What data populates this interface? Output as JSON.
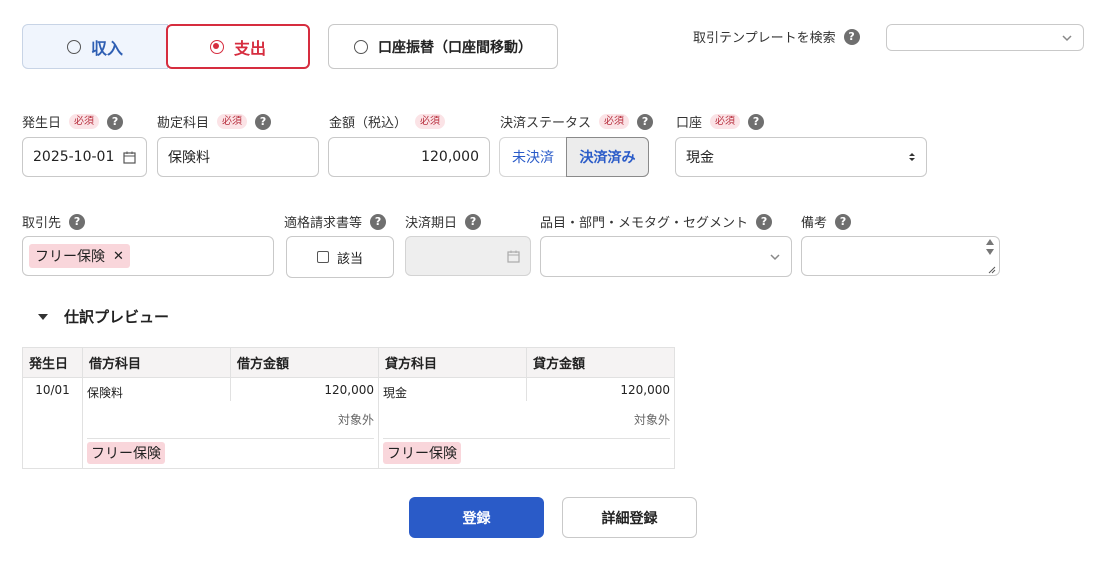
{
  "tabs": {
    "income": "収入",
    "expense": "支出",
    "transfer": "口座振替（口座間移動）"
  },
  "template_search": {
    "label": "取引テンプレートを検索",
    "value": ""
  },
  "required_badge": "必須",
  "help_glyph": "?",
  "fields": {
    "date": {
      "label": "発生日",
      "value": "2025-10-01"
    },
    "account_item": {
      "label": "勘定科目",
      "value": "保険料"
    },
    "amount": {
      "label": "金額（税込）",
      "value": "120,000"
    },
    "status": {
      "label": "決済ステータス",
      "options": [
        "未決済",
        "決済済み"
      ],
      "selected": "決済済み"
    },
    "wallet": {
      "label": "口座",
      "value": "現金"
    },
    "partner": {
      "label": "取引先",
      "tag": "フリー保険",
      "remove_glyph": "✕"
    },
    "invoice": {
      "label": "適格請求書等",
      "checkbox_label": "該当",
      "checked": false
    },
    "due_date": {
      "label": "決済期日",
      "value": ""
    },
    "segments": {
      "label": "品目・部門・メモタグ・セグメント",
      "value": ""
    },
    "memo": {
      "label": "備考",
      "value": ""
    }
  },
  "preview": {
    "title": "仕訳プレビュー",
    "headers": [
      "発生日",
      "借方科目",
      "借方金額",
      "貸方科目",
      "貸方金額"
    ],
    "row": {
      "date": "10/01",
      "debit_account": "保険料",
      "debit_amount": "120,000",
      "debit_tax": "対象外",
      "credit_account": "現金",
      "credit_amount": "120,000",
      "credit_tax": "対象外",
      "debit_partner": "フリー保険",
      "credit_partner": "フリー保険"
    }
  },
  "buttons": {
    "register": "登録",
    "detail_register": "詳細登録"
  },
  "colors": {
    "accent_red": "#d62d3f",
    "primary_blue": "#2a5bc8",
    "tag_pink": "#f9d6db"
  }
}
